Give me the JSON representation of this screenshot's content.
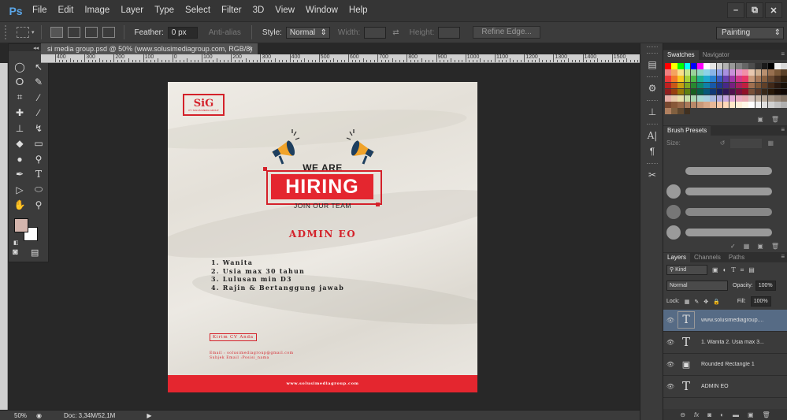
{
  "app": {
    "logo": "Ps"
  },
  "menu": [
    "File",
    "Edit",
    "Image",
    "Layer",
    "Type",
    "Select",
    "Filter",
    "3D",
    "View",
    "Window",
    "Help"
  ],
  "window_controls": {
    "minimize": "–",
    "restore": "⧉",
    "close": "✕"
  },
  "options_bar": {
    "feather_label": "Feather:",
    "feather_value": "0 px",
    "antialias_label": "Anti-alias",
    "style_label": "Style:",
    "style_value": "Normal",
    "width_label": "Width:",
    "height_label": "Height:",
    "refine_edge": "Refine Edge...",
    "workspace": "Painting"
  },
  "document": {
    "tab_title": "si media group.psd @ 50% (www.solusimediagroup.com, RGB/8)",
    "tab_close": "×",
    "ruler_labels": [
      "400",
      "300",
      "200",
      "100",
      "0",
      "100",
      "200",
      "300",
      "400",
      "500",
      "600",
      "700",
      "800",
      "900",
      "1000",
      "1100",
      "1200",
      "1300",
      "1400",
      "1500"
    ]
  },
  "poster": {
    "logo_text": "SiG",
    "logo_sub": "PT. SOLUSI MEDIA GROUP",
    "we_are": "WE ARE",
    "hiring": "HIRING",
    "join": "JOIN OUR TEAM",
    "position": "ADMIN EO",
    "requirements": [
      "1. Wanita",
      "2. Usia max 30 tahun",
      "3. Lulusan min D3",
      "4. Rajin & Bertanggung jawab"
    ],
    "send_cv": "Kirim CV Anda",
    "email_line": "Email : solusimediagroup@gmail.com",
    "subject_line": "Subjek Email :Posisi_nama",
    "website": "www.solusimediagroup.com",
    "colors": {
      "brand_red": "#e4262f",
      "megaphone_orange": "#f0a32a",
      "megaphone_blue": "#1e3f5f"
    }
  },
  "status": {
    "zoom": "50%",
    "doc": "Doc: 3,34M/52,1M"
  },
  "panels": {
    "swatches_tabs": [
      "Swatches",
      "Navigator"
    ],
    "brush_presets_tab": "Brush Presets",
    "brush_size_label": "Size:",
    "layers_tabs": [
      "Layers",
      "Channels",
      "Paths"
    ],
    "kind_label": "Kind",
    "blend_mode": "Normal",
    "opacity_label": "Opacity:",
    "opacity_value": "100%",
    "lock_label": "Lock:",
    "fill_label": "Fill:",
    "fill_value": "100%",
    "layers": [
      {
        "name": "www.solusimediagroup....",
        "type": "text",
        "selected": true
      },
      {
        "name": "1. Wanita 2. Usia max 3...",
        "type": "text",
        "selected": false
      },
      {
        "name": "Rounded Rectangle 1",
        "type": "shape",
        "selected": false
      },
      {
        "name": "ADMIN EO",
        "type": "text",
        "selected": false
      }
    ],
    "bottom_icons": [
      "link-icon",
      "fx-icon",
      "mask-icon",
      "adjustment-icon",
      "folder-icon",
      "new-layer-icon",
      "trash-icon"
    ]
  },
  "tools": [
    "marquee-icon",
    "move-icon",
    "lasso-icon",
    "quick-select-icon",
    "crop-icon",
    "eyedropper-icon",
    "healing-icon",
    "brush-icon",
    "stamp-icon",
    "history-brush-icon",
    "eraser-icon",
    "gradient-icon",
    "blur-icon",
    "dodge-icon",
    "pen-icon",
    "type-icon",
    "path-select-icon",
    "ellipse-icon",
    "hand-icon",
    "zoom-icon"
  ]
}
